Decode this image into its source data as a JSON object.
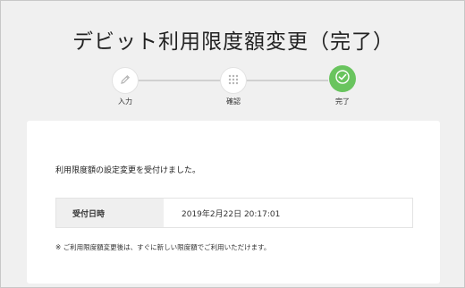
{
  "page": {
    "title": "デビット利用限度額変更（完了）"
  },
  "stepper": {
    "steps": [
      {
        "label": "入力",
        "icon": "pencil-icon",
        "state": "done"
      },
      {
        "label": "確認",
        "icon": "grid-icon",
        "state": "done"
      },
      {
        "label": "完了",
        "icon": "check-icon",
        "state": "current"
      }
    ],
    "colors": {
      "active": "#69c45e",
      "inactive_icon": "#b5b5b5"
    }
  },
  "result": {
    "message": "利用限度額の設定変更を受付けました。",
    "table": {
      "header": "受付日時",
      "value": "2019年2月22日 20:17:01"
    },
    "note": "※ ご利用限度額変更後は、すぐに新しい限度額でご利用いただけます。"
  }
}
